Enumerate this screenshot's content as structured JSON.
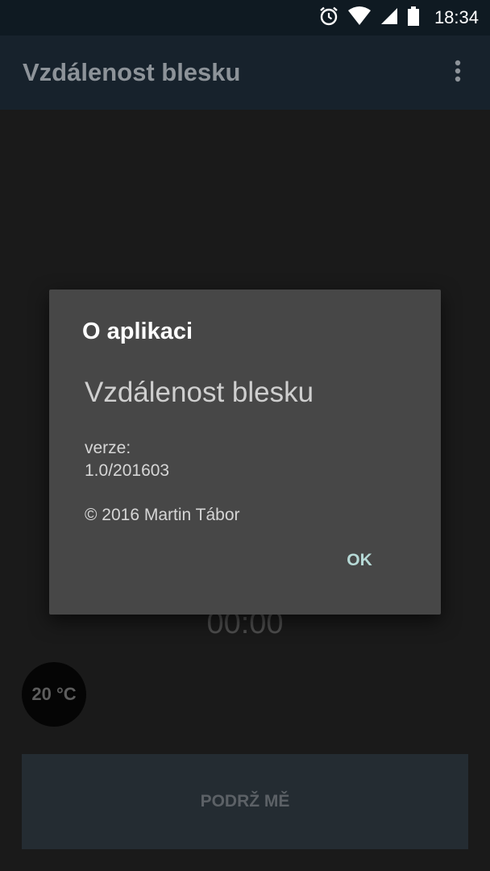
{
  "status_bar": {
    "time": "18:34",
    "icons": [
      "alarm-icon",
      "wifi-icon",
      "signal-icon",
      "battery-icon"
    ]
  },
  "app_bar": {
    "title": "Vzdálenost blesku",
    "menu_icon": "more-vert-icon"
  },
  "main": {
    "timer": "00:00",
    "temperature": "20 °C",
    "hold_button_label": "PODRŽ MĚ"
  },
  "dialog": {
    "title": "O aplikaci",
    "app_name": "Vzdálenost blesku",
    "version_label": "verze:",
    "version": "1.0/201603",
    "copyright": "© 2016 Martin Tábor",
    "ok_label": "OK"
  },
  "colors": {
    "background": "#1a1a1a",
    "app_bar": "#17222c",
    "dialog": "#474747",
    "accent": "#b6d9d6"
  }
}
